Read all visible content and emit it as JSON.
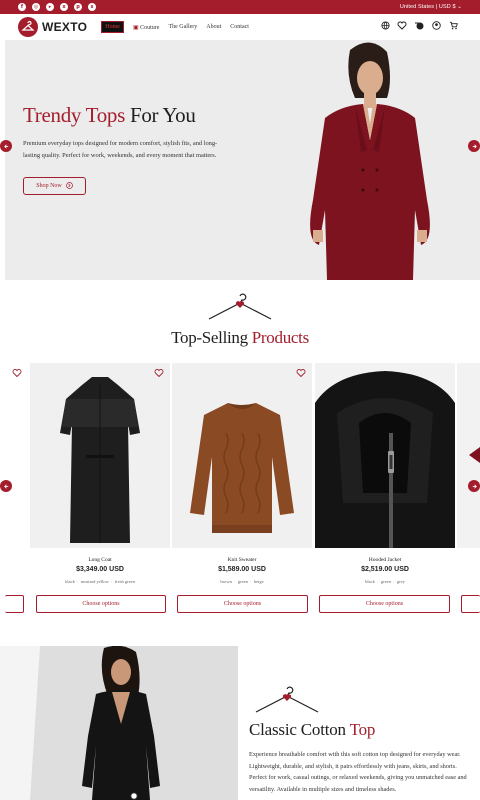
{
  "topbar": {
    "social_icons": [
      "facebook-icon",
      "instagram-icon",
      "youtube-icon",
      "x-icon",
      "pinterest-icon",
      "snapchat-icon"
    ],
    "region": "United States | USD $"
  },
  "header": {
    "logo_text": "WEXTO",
    "nav": [
      "Home",
      "Couture",
      "The Gallery",
      "About",
      "Contact"
    ],
    "icons": [
      "globe-icon",
      "wishlist-icon",
      "compare-icon",
      "account-icon",
      "cart-icon"
    ]
  },
  "hero": {
    "title_red": "Trendy Tops",
    "title_dark": " For You",
    "description": "Premium everyday tops designed for modern comfort, stylish fits, and long-lasting quality. Perfect for work, weekends, and every moment that matters.",
    "button": "Shop Now"
  },
  "products_section": {
    "title_dark": "Top-Selling ",
    "title_red": "Products",
    "items": [
      {
        "name": "Long Coat",
        "price": "$3,349.00 USD",
        "colors": [
          "black",
          "mustard yellow",
          "fresh green"
        ],
        "button": "Choose options"
      },
      {
        "name": "Knit Sweater",
        "price": "$1,589.00 USD",
        "colors": [
          "brown",
          "green",
          "beige"
        ],
        "button": "Choose options"
      },
      {
        "name": "Hooded Jacket",
        "price": "$2,519.00 USD",
        "colors": [
          "black",
          "green",
          "grey"
        ],
        "button": "Choose options"
      }
    ]
  },
  "feature": {
    "title_dark": "Classic Cotton ",
    "title_red": "Top",
    "description": "Experience breathable comfort with this soft cotton top designed for everyday wear. Lightweight, durable, and stylish, it pairs effortlessly with jeans, skirts, and shorts. Perfect for work, casual outings, or relaxed weekends, giving you unmatched ease and versatility. Available in multiple sizes and timeless shades."
  },
  "colors": {
    "accent": "#a31d2c",
    "hero_bg": "#ececec"
  }
}
